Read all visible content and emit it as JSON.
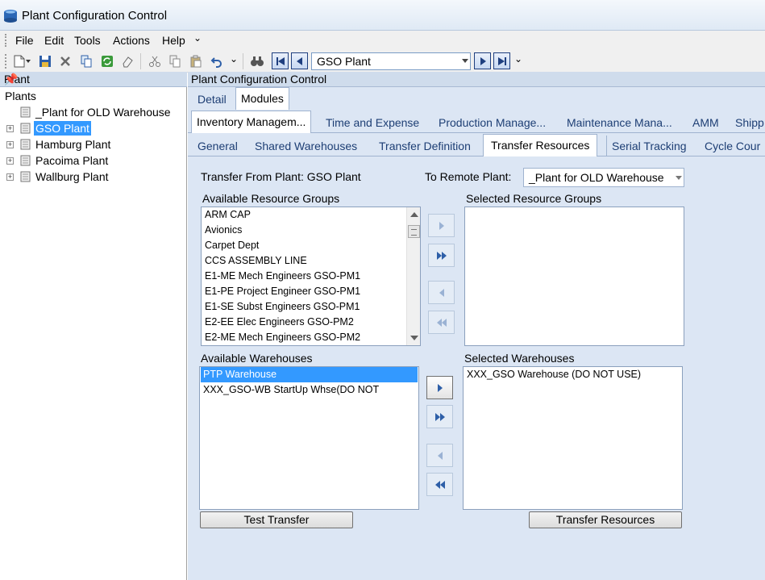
{
  "window": {
    "title": "Plant Configuration Control"
  },
  "menu": {
    "items": [
      "File",
      "Edit",
      "Tools",
      "Actions",
      "Help"
    ]
  },
  "toolbar": {
    "plant_combo_value": "GSO Plant"
  },
  "left_panel": {
    "header": "Plant",
    "root": "Plants",
    "nodes": [
      "_Plant for OLD Warehouse",
      "GSO Plant",
      "Hamburg Plant",
      "Pacoima Plant",
      "Wallburg Plant"
    ],
    "selected": "GSO Plant"
  },
  "right_panel": {
    "header": "Plant Configuration Control",
    "tabs_top": [
      "Detail",
      "Modules"
    ],
    "tabs_modules": [
      "Inventory  Managem...",
      "Time and Expense",
      "Production  Manage...",
      "Maintenance  Mana...",
      "AMM",
      "Shipp"
    ],
    "tabs_inventory": [
      "General",
      "Shared Warehouses",
      "Transfer Definition",
      "Transfer Resources",
      "Serial Tracking",
      "Cycle Cour"
    ]
  },
  "transfer": {
    "from_label": "Transfer From Plant: GSO Plant",
    "to_label": "To Remote Plant:",
    "to_value": "_Plant for OLD Warehouse",
    "available_groups_label": "Available Resource Groups",
    "selected_groups_label": "Selected Resource Groups",
    "available_groups": [
      "ARM CAP",
      "Avionics",
      "Carpet Dept",
      "CCS ASSEMBLY LINE",
      "E1-ME Mech Engineers GSO-PM1",
      "E1-PE Project Engineer GSO-PM1",
      "E1-SE Subst Engineers GSO-PM1",
      "E2-EE Elec Engineers GSO-PM2",
      "E2-ME Mech Engineers GSO-PM2"
    ],
    "selected_groups": [],
    "available_warehouses_label": "Available Warehouses",
    "selected_warehouses_label": "Selected Warehouses",
    "available_warehouses": [
      "PTP Warehouse",
      "XXX_GSO-WB StartUp Whse(DO NOT"
    ],
    "selected_warehouses": [
      "XXX_GSO Warehouse (DO NOT USE)"
    ],
    "test_button": "Test Transfer",
    "transfer_button": "Transfer Resources"
  },
  "colors": {
    "accent": "#3399ff",
    "panel": "#dce6f4",
    "header": "#cfdcec"
  }
}
